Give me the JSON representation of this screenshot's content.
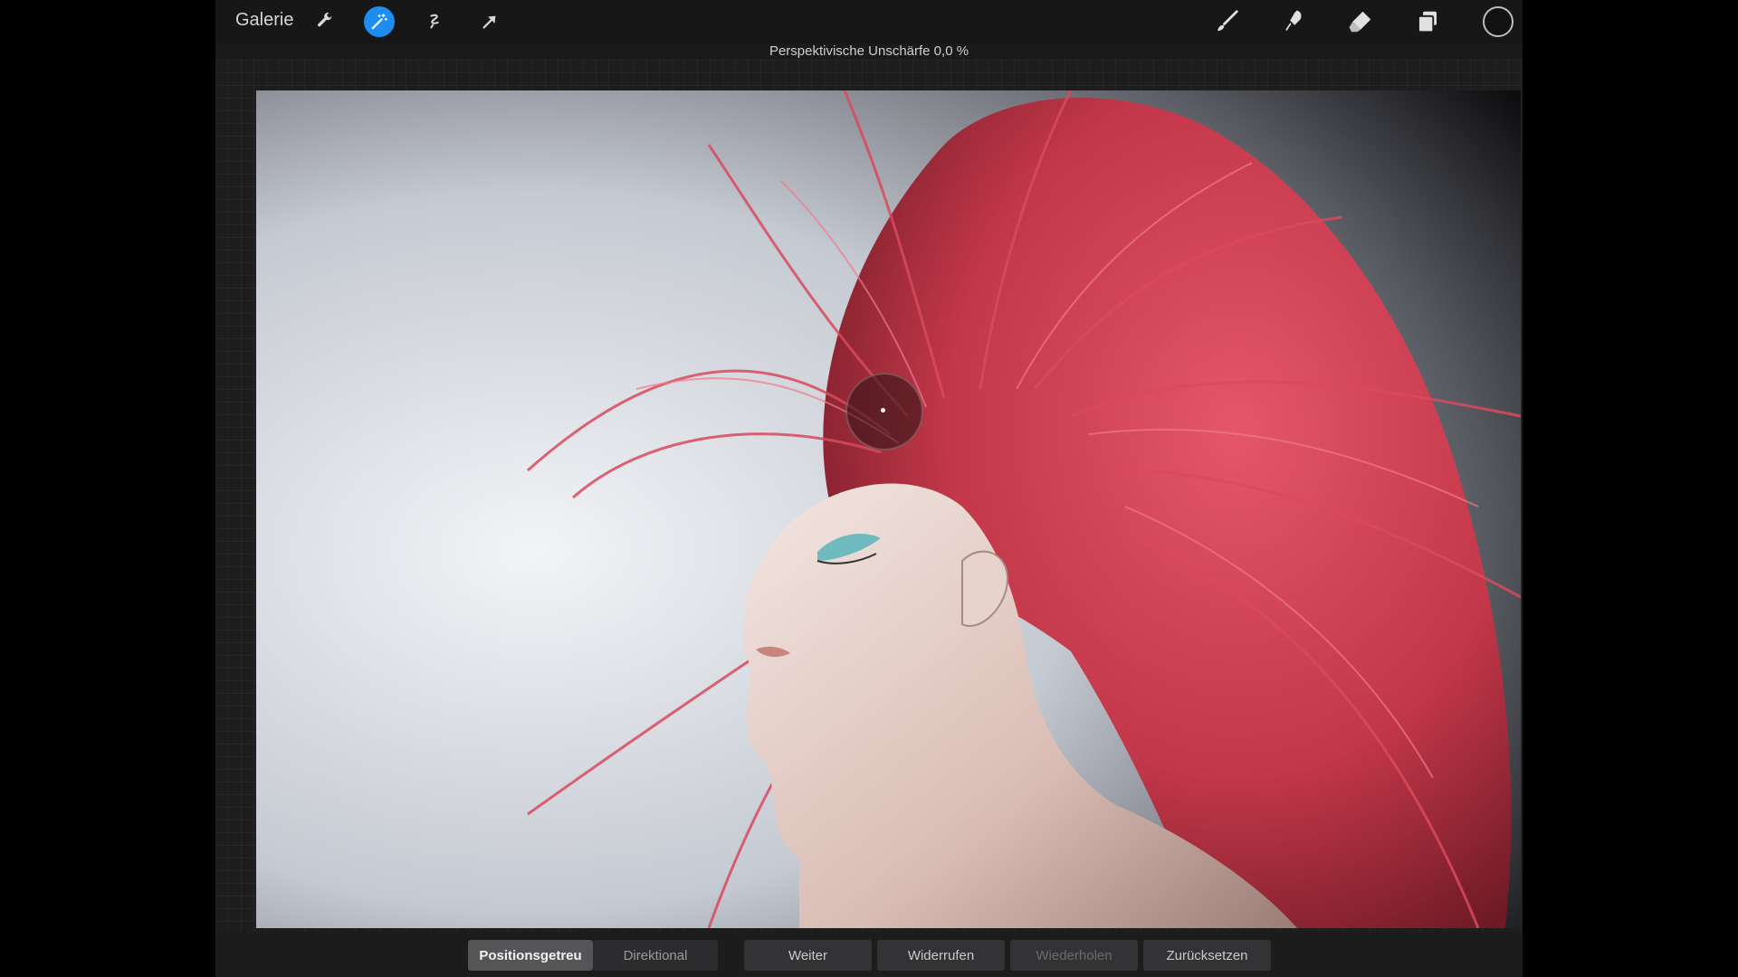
{
  "topbar": {
    "gallery_label": "Galerie",
    "left_tools": [
      "wrench-icon",
      "magic-wand-icon",
      "selection-icon",
      "transform-arrow-icon"
    ],
    "active_tool": "magic-wand-icon",
    "right_tools": [
      "brush-icon",
      "smudge-icon",
      "eraser-icon",
      "layers-icon"
    ],
    "current_color": "#111111"
  },
  "hud": {
    "text": "Perspektivische Unschärfe 0,0 %"
  },
  "canvas": {
    "image_subject": "woman with flying red hair",
    "blur_handle_icon": "focus-point-icon"
  },
  "bottombar": {
    "mode_positional": "Positionsgetreu",
    "mode_directional": "Direktional",
    "next_label": "Weiter",
    "undo_label": "Widerrufen",
    "redo_label": "Wiederholen",
    "reset_label": "Zurücksetzen"
  },
  "colors": {
    "accent": "#1f8cf0",
    "hair": "#e24a5c",
    "background_ui": "#1a1a1b"
  }
}
